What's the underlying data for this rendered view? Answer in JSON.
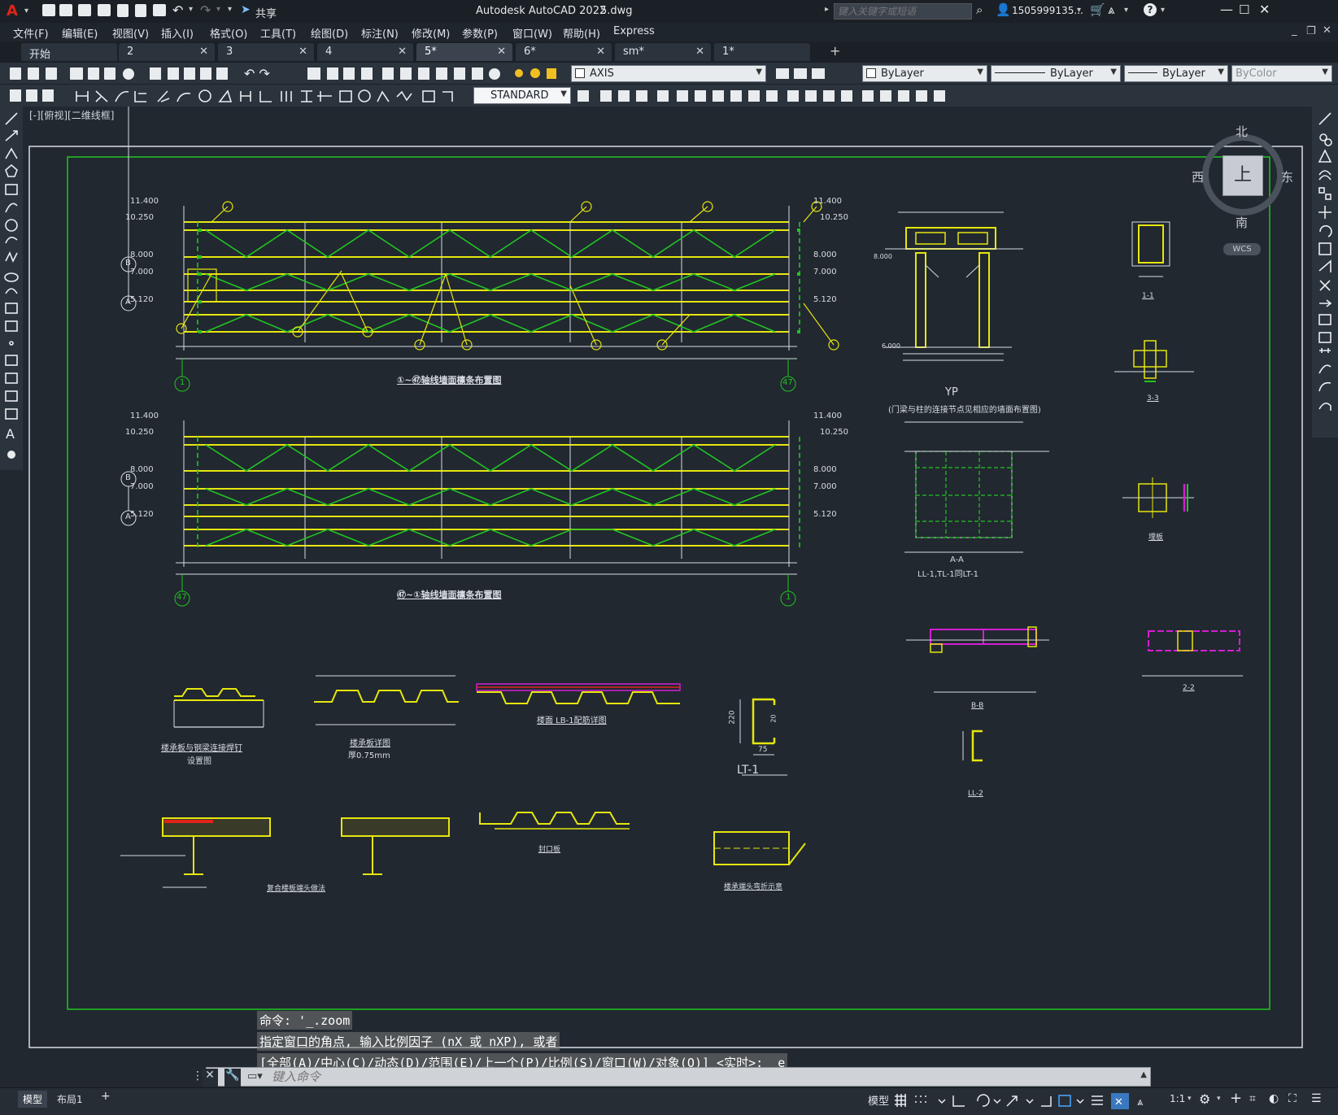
{
  "titlebar": {
    "app_letter": "A",
    "share_label": "共享",
    "title": "Autodesk AutoCAD 2022",
    "file": "5.dwg",
    "search_placeholder": "键入关键字或短语",
    "user": "1505999135...",
    "help": "?"
  },
  "menu": [
    "文件(F)",
    "编辑(E)",
    "视图(V)",
    "插入(I)",
    "格式(O)",
    "工具(T)",
    "绘图(D)",
    "标注(N)",
    "修改(M)",
    "参数(P)",
    "窗口(W)",
    "帮助(H)",
    "Express"
  ],
  "tabs": [
    {
      "label": "开始",
      "active": false,
      "close": false
    },
    {
      "label": "2",
      "active": false,
      "close": true
    },
    {
      "label": "3",
      "active": false,
      "close": true
    },
    {
      "label": "4",
      "active": false,
      "close": true
    },
    {
      "label": "5*",
      "active": true,
      "close": true
    },
    {
      "label": "6*",
      "active": false,
      "close": true
    },
    {
      "label": "sm*",
      "active": false,
      "close": true
    },
    {
      "label": "1*",
      "active": false,
      "close": false
    }
  ],
  "toolbar": {
    "layer": "AXIS",
    "color": "ByLayer",
    "linetype": "ByLayer",
    "lineweight": "ByLayer",
    "plotstyle": "ByColor",
    "textstyle": "STANDARD"
  },
  "viewport_label": "[-][俯视][二维线框]",
  "viewcube": {
    "north": "北",
    "south": "南",
    "east": "东",
    "west": "西",
    "face": "上",
    "wcs": "WCS"
  },
  "drawing": {
    "elev1": [
      "11.400",
      "10.250",
      "8.000",
      "7.000",
      "5.120"
    ],
    "elev2": [
      "11.400",
      "10.250",
      "8.000",
      "7.000",
      "5.120"
    ],
    "axis_b": "B",
    "axis_a": "A",
    "grid1_left": "1",
    "grid1_right": "47",
    "grid2_left": "47",
    "grid2_right": "1",
    "elev_yp": "8.000",
    "elev_yp_base": "6.000",
    "title1": "①~㊼轴线墙面檩条布置图",
    "title2": "㊼~①轴线墙面檩条布置图",
    "yp_title": "YP",
    "yp_sub": "(门梁与柱的连接节点见相应的墙面布置图)",
    "sec11": "1-1",
    "sec33": "3-3",
    "sec_label_other": "埋板",
    "aa_title": "A-A",
    "aa_sub": "LL-1,TL-1同LT-1",
    "bb_title": "B-B",
    "s22_title": "2-2",
    "lt1_title": "LT-1",
    "ll2_title": "LL-2",
    "dim_220": "220",
    "dim_75": "75",
    "dim_20": "20",
    "d1_t1": "楼承板与钢梁连接焊钉",
    "d1_t2": "设置图",
    "d2_t1": "楼承板详图",
    "d2_t2": "厚0.75mm",
    "d3_t1": "楼面 LB-1配筋详图",
    "d5_t1": "复合楼板端头做法",
    "d7_t1": "封口板",
    "d8_t1": "楼承端头弯折示意"
  },
  "command": {
    "line1": "命令: '_.zoom",
    "line2": "指定窗口的角点, 输入比例因子 (nX 或 nXP), 或者",
    "line3": "[全部(A)/中心(C)/动态(D)/范围(E)/上一个(P)/比例(S)/窗口(W)/对象(O)] <实时>: _e",
    "placeholder": "键入命令"
  },
  "layout_tabs": [
    "模型",
    "布局1"
  ],
  "status": {
    "model": "模型",
    "scale": "1:1"
  },
  "colors": {
    "green": "#22c322",
    "yellow": "#e6e60e",
    "magenta": "#d21ed2",
    "bg": "#212830"
  }
}
